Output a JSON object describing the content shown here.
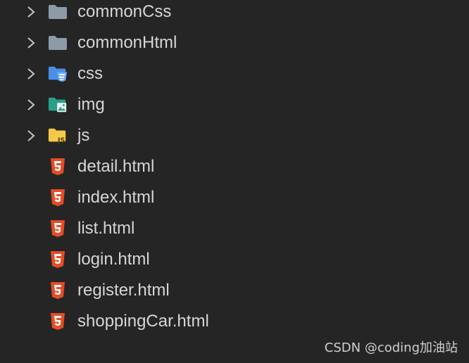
{
  "explorer": {
    "items": [
      {
        "label": "commonCss",
        "type": "folder",
        "icon": "folder-icon",
        "color": "#8d9aa8"
      },
      {
        "label": "commonHtml",
        "type": "folder",
        "icon": "folder-icon",
        "color": "#8d9aa8"
      },
      {
        "label": "css",
        "type": "folder",
        "icon": "css-folder-icon",
        "color": "#4a8ee8"
      },
      {
        "label": "img",
        "type": "folder",
        "icon": "image-folder-icon",
        "color": "#2b9e8a"
      },
      {
        "label": "js",
        "type": "folder",
        "icon": "js-folder-icon",
        "color": "#f5c84b"
      },
      {
        "label": "detail.html",
        "type": "file",
        "icon": "html5-icon",
        "color": "#e44d26"
      },
      {
        "label": "index.html",
        "type": "file",
        "icon": "html5-icon",
        "color": "#e44d26"
      },
      {
        "label": "list.html",
        "type": "file",
        "icon": "html5-icon",
        "color": "#e44d26"
      },
      {
        "label": "login.html",
        "type": "file",
        "icon": "html5-icon",
        "color": "#e44d26"
      },
      {
        "label": "register.html",
        "type": "file",
        "icon": "html5-icon",
        "color": "#e44d26"
      },
      {
        "label": "shoppingCar.html",
        "type": "file",
        "icon": "html5-icon",
        "color": "#e44d26"
      }
    ]
  },
  "watermark": "CSDN @coding加油站",
  "colors": {
    "background": "#252526",
    "text": "#d6d6d6",
    "chevron": "#c5c5c5"
  }
}
